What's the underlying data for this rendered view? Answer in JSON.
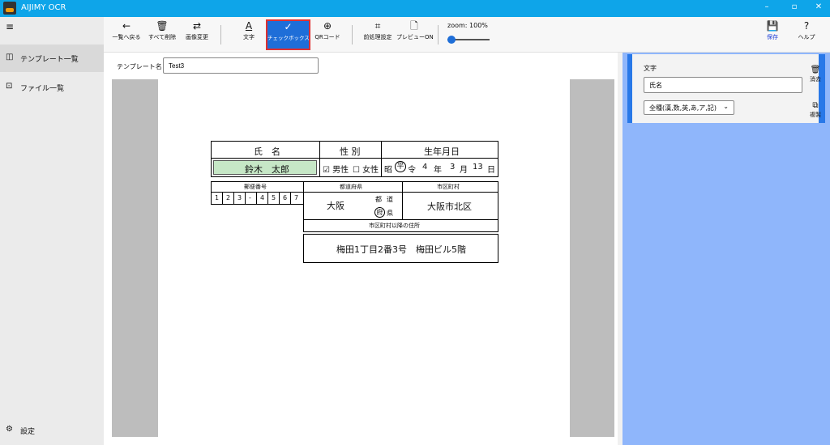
{
  "app": {
    "title": "AIJIMY OCR"
  },
  "window": {
    "minimize": "–",
    "restore": "▫",
    "close": "✕"
  },
  "sidebar": {
    "menu_icon": "≡",
    "items": [
      {
        "icon": "template-list-icon",
        "glyph": "◫",
        "label": "テンプレート一覧"
      },
      {
        "icon": "file-list-icon",
        "glyph": "⊡",
        "label": "ファイル一覧"
      }
    ],
    "settings": {
      "icon": "gear-icon",
      "glyph": "⚙",
      "label": "設定"
    }
  },
  "toolbar": {
    "buttons": [
      {
        "icon": "arrow-left-icon",
        "glyph": "←",
        "label": "一覧へ戻る"
      },
      {
        "icon": "trash-icon",
        "glyph": "🗑",
        "label": "すべて削除"
      },
      {
        "icon": "swap-icon",
        "glyph": "⇄",
        "label": "画像変更"
      },
      {
        "icon": "text-icon",
        "glyph": "A",
        "label": "文字"
      },
      {
        "icon": "checkmark-icon",
        "glyph": "✓",
        "label": "チェックボックス"
      },
      {
        "icon": "globe-icon",
        "glyph": "⊕",
        "label": "QRコード"
      },
      {
        "icon": "crop-icon",
        "glyph": "⌗",
        "label": "前処理設定"
      },
      {
        "icon": "document-icon",
        "glyph": "🗋",
        "label": "プレビューON"
      }
    ],
    "zoom_label": "zoom:  100%",
    "save": {
      "icon": "save-icon",
      "glyph": "💾",
      "label": "保存"
    },
    "help": {
      "icon": "help-icon",
      "glyph": "?",
      "label": "ヘルプ"
    }
  },
  "template": {
    "label": "テンプレート名：",
    "value": "Test3"
  },
  "form": {
    "name_header": "氏　名",
    "gender_header": "性 別",
    "birth_header": "生年月日",
    "name_value": "鈴木　太郎",
    "gender_male": "☑ 男性",
    "gender_female": "☐ 女性",
    "era_showa": "昭",
    "era_heisei": "平",
    "era_reiwa": "令",
    "birth_year": "4",
    "year_unit": "年",
    "birth_month": "3",
    "month_unit": "月",
    "birth_day": "13",
    "day_unit": "日",
    "postal_header": "郵便番号",
    "postal_digits": [
      "1",
      "2",
      "3",
      "-",
      "4",
      "5",
      "6",
      "7"
    ],
    "pref_header": "都道府県",
    "pref_value": "大阪",
    "pref_to": "都",
    "pref_do": "道",
    "pref_fu": "府",
    "pref_ken": "県",
    "city_header": "市区町村",
    "city_value": "大阪市北区",
    "addr_header": "市区町村以降の住所",
    "addr_value": "梅田1丁目2番3号　梅田ビル5階"
  },
  "panel": {
    "title": "文字",
    "field_value": "氏名",
    "type_select": "全種(漢,数,英,あ,ア,記)",
    "delete": {
      "icon": "trash-icon",
      "glyph": "🗑",
      "label": "消去"
    },
    "copy": {
      "icon": "copy-icon",
      "glyph": "⧉",
      "label": "複製"
    }
  },
  "colors": {
    "accent": "#0ea5e9",
    "active": "#1e6ed8",
    "highlight": "#e03030",
    "panel": "#8fb6fb",
    "name_field": "#c6e7c6"
  }
}
